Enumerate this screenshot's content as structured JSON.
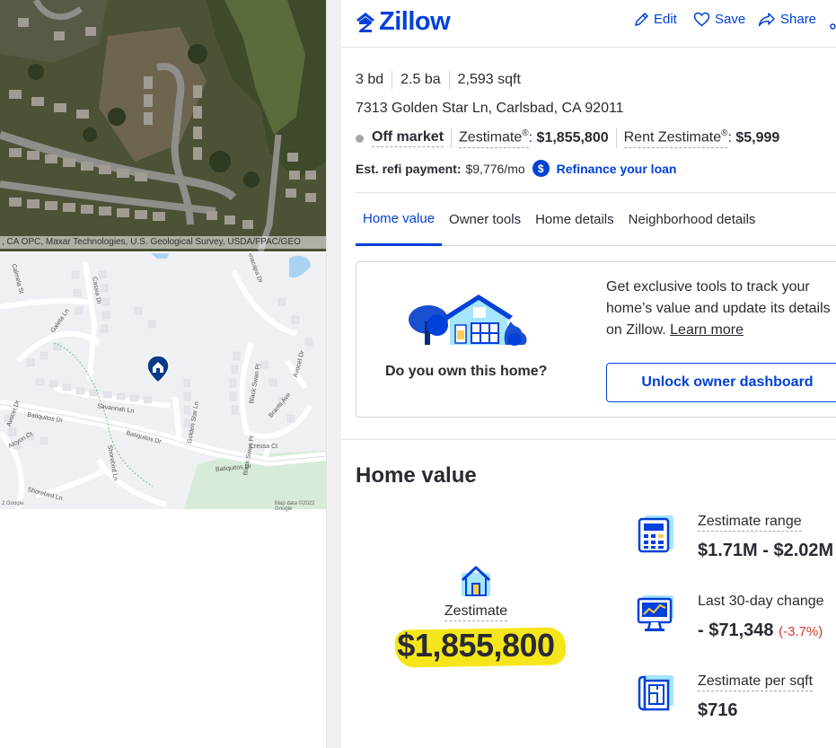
{
  "map": {
    "satellite_attribution": ", CA OPC, Maxar Technologies, U.S. Geological Survey, USDA/FPAC/GEO",
    "credit_left": "2 Google",
    "credit_right": "Map data ©2022 Google",
    "street_labels": [
      "Calmela St",
      "Cassia Dr",
      "Galeta Ln",
      "Savannah Ln",
      "Batiquitos Dr",
      "Batiquitos Dr",
      "Batiquitos Dr",
      "Golden Star Ln",
      "Black Swan Pl",
      "Black Swan Pl",
      "Brants Ave",
      "Cressa Ct",
      "Shorebird Ln",
      "Shorebird Ln",
      "Avocet Dr",
      "Avocet Dr",
      "Alcyon Ct",
      "Anacapa Dr"
    ]
  },
  "header": {
    "logo_text": "Zillow",
    "edit_label": "Edit",
    "save_label": "Save",
    "share_label": "Share"
  },
  "home": {
    "beds": "3 bd",
    "baths": "2.5 ba",
    "sqft": "2,593 sqft",
    "address": "7313 Golden Star Ln, Carlsbad, CA 92011",
    "status": "Off market",
    "zestimate_label": "Zestimate",
    "reg_mark": "®",
    "zestimate_value": "$1,855,800",
    "rent_label": "Rent Zestimate",
    "rent_value": "$5,999",
    "refi_label": "Est. refi payment:",
    "refi_value": "$9,776/mo",
    "refi_link": "Refinance your loan"
  },
  "tabs": [
    "Home value",
    "Owner tools",
    "Home details",
    "Neighborhood details"
  ],
  "owner_card": {
    "question": "Do you own this home?",
    "description": "Get exclusive tools to track your home’s value and update its details on Zillow.",
    "learn_more": "Learn more",
    "button": "Unlock owner dashboard"
  },
  "home_value": {
    "title": "Home value",
    "zestimate_label": "Zestimate",
    "zestimate_value": "$1,855,800",
    "range_label": "Zestimate range",
    "range_value": "$1.71M - $2.02M",
    "change_label": "Last 30-day change",
    "change_value": "- $71,348",
    "change_pct": "(-3.7%)",
    "per_sqft_label": "Zestimate per sqft",
    "per_sqft_value": "$716"
  },
  "colors": {
    "brand_blue": "#0041d9",
    "highlight_yellow": "#f5e61b",
    "negative_red": "#d1392c"
  }
}
